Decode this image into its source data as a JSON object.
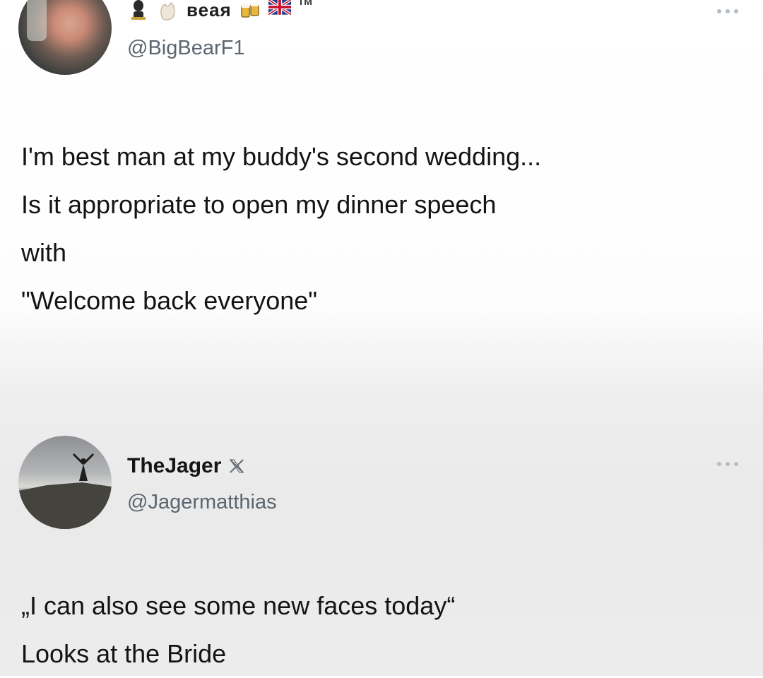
{
  "posts": [
    {
      "display_name": "веая",
      "handle": "@BigBearF1",
      "trademark": "TM",
      "lines": [
        "I'm best man at my buddy's second wedding...",
        "Is it appropriate to open my dinner speech",
        "with",
        "\"Welcome back everyone\""
      ],
      "icons": [
        "figure-emoji-icon",
        "waving-hand-icon",
        "beer-mugs-icon",
        "uk-flag-icon",
        "more-options-icon"
      ]
    },
    {
      "display_name": "TheJager",
      "handle": "@Jagermatthias",
      "lines": [
        "„I can also see some new faces today“",
        "Looks at the Bride"
      ],
      "icons": [
        "x-logo-icon",
        "more-options-icon"
      ]
    }
  ],
  "colors": {
    "text": "#141414",
    "handle": "#5b6670",
    "more_icon": "#b5bcc2"
  }
}
